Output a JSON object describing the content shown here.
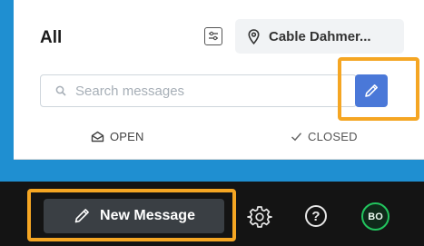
{
  "header": {
    "title": "All",
    "location_label": "Cable Dahmer...",
    "filter_icon": "sliders-icon",
    "location_icon": "map-pin-icon"
  },
  "search": {
    "placeholder": "Search messages",
    "value": "",
    "icon": "search-icon"
  },
  "compose": {
    "icon": "pencil-icon",
    "color": "#4a78d8"
  },
  "tabs": [
    {
      "label": "OPEN",
      "icon": "envelope-open-icon"
    },
    {
      "label": "CLOSED",
      "icon": "check-icon"
    }
  ],
  "bottom_bar": {
    "new_message_label": "New Message",
    "new_message_icon": "pencil-icon",
    "settings_icon": "gear-icon",
    "help_label": "?",
    "avatar_initials": "BO"
  },
  "colors": {
    "accent_blue": "#1f8fd1",
    "highlight": "#f5a623",
    "bottom_bar": "#141414",
    "avatar_ring": "#22c55e"
  }
}
